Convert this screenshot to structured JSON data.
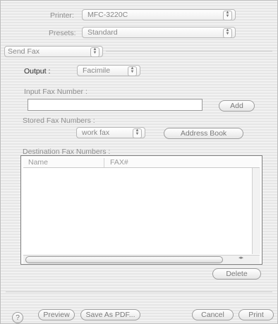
{
  "printer": {
    "label": "Printer:",
    "value": "MFC-3220C"
  },
  "presets": {
    "label": "Presets:",
    "value": "Standard"
  },
  "panel": {
    "value": "Send Fax"
  },
  "output": {
    "label": "Output :",
    "value": "Facimile"
  },
  "input_fax": {
    "label": "Input Fax Number :",
    "value": "",
    "add_label": "Add"
  },
  "stored": {
    "label": "Stored Fax Numbers :",
    "value": "work fax",
    "address_book_label": "Address Book"
  },
  "destination": {
    "label": "Destination Fax Numbers :",
    "columns": [
      "Name",
      "FAX#"
    ],
    "delete_label": "Delete"
  },
  "footer": {
    "help": "?",
    "preview": "Preview",
    "save_pdf": "Save As PDF...",
    "cancel": "Cancel",
    "print": "Print"
  }
}
